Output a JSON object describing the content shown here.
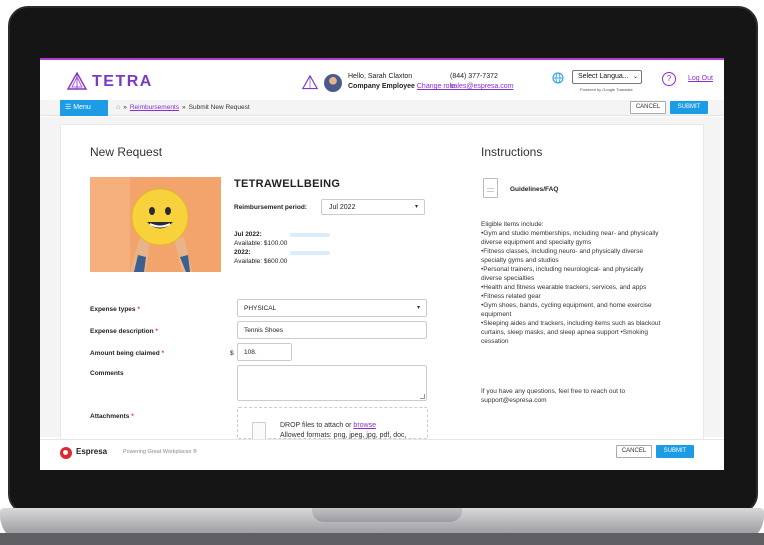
{
  "header": {
    "logo_text": "TETRA",
    "greeting": "Hello, Sarah Claxton",
    "role": "Company Employee",
    "change_role": "Change role",
    "phone": "(844) 377-7372",
    "email": "sales@espresa.com",
    "language_select": "Select Langua...",
    "powered_by": "Powered by Google Translate",
    "help": "?",
    "logout": "Log Out"
  },
  "nav": {
    "menu": "Menu",
    "breadcrumb_link": "Reimbursements",
    "breadcrumb_sep": "»",
    "breadcrumb_current": "Submit New Request",
    "cancel": "CANCEL",
    "submit": "SUBMIT"
  },
  "form": {
    "title": "New Request",
    "program": "TETRAWELLBEING",
    "period_label": "Reimbursement period:",
    "period_value": "Jul 2022",
    "avail_1_label": "Jul 2022:",
    "avail_1_value": "Available: $100.00",
    "avail_2_label": "2022:",
    "avail_2_value": "Available: $600.00",
    "expense_type_label": "Expense types",
    "expense_type_value": "PHYSICAL",
    "description_label": "Expense description",
    "description_value": "Tennis Shoes",
    "amount_label": "Amount being claimed",
    "currency": "$",
    "amount_value": "108.",
    "comments_label": "Comments",
    "attachments_label": "Attachments",
    "required_mark": "*",
    "drop_text": "DROP files to attach or",
    "browse": "browse",
    "formats": "Allowed formats: png, jpeg, jpg, pdf, doc,"
  },
  "instructions": {
    "title": "Instructions",
    "guidelines": "Guidelines/FAQ",
    "intro": "Eligible items include:",
    "items": [
      "•Gym and studio memberships, including near- and physically diverse equipment and specialty gyms",
      "•Fitness classes, including neuro- and physically diverse specialty gyms and studios",
      "•Personal trainers, including neurological- and physically diverse specialties",
      "•Health and fitness wearable trackers, services, and apps •Fitness related gear",
      "•Gym shoes, bands, cycling equipment, and home exercise equipment",
      "•Sleeping aides and trackers, including items such as blackout curtains, sleep masks, and sleep apnea support •Smoking cessation"
    ],
    "contact": "If you have any questions, feel free to reach out to support@espresa.com"
  },
  "footer": {
    "brand": "Espresa",
    "tagline": "Powering Great Workplaces ®",
    "cancel": "CANCEL",
    "submit": "SUBMIT"
  },
  "colors": {
    "brand_purple": "#7a3ac6",
    "link_purple": "#8a2ed6",
    "primary_blue": "#1b9ce5",
    "required_red": "#d33333",
    "espresa_red": "#e0262e"
  }
}
